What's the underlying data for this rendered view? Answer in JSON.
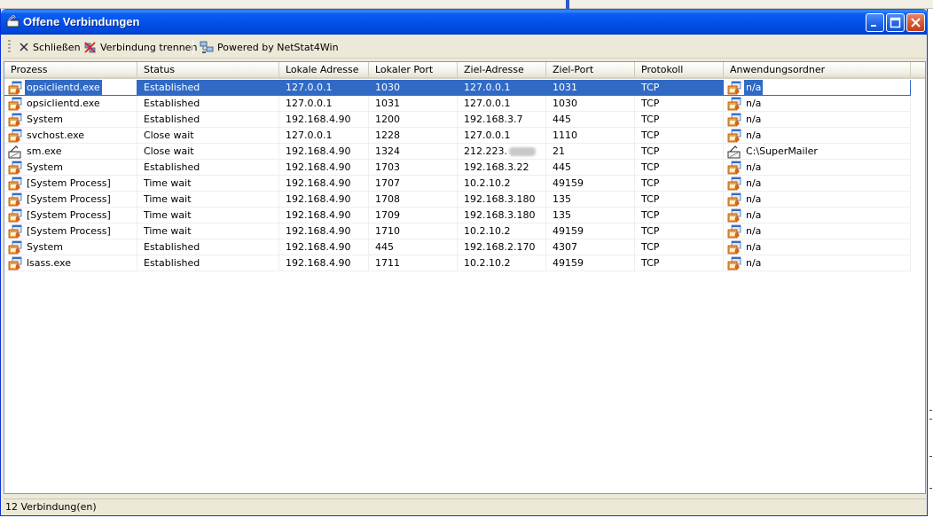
{
  "window": {
    "title": "Offene Verbindungen",
    "minimize_label": "Minimieren",
    "maximize_label": "Maximieren",
    "close_label": "Schließen"
  },
  "toolbar": {
    "close_label": "Schließen",
    "disconnect_label": "Verbindung trennen",
    "powered_label": "Powered by NetStat4Win"
  },
  "columns": [
    {
      "key": "process",
      "label": "Prozess"
    },
    {
      "key": "status",
      "label": "Status"
    },
    {
      "key": "local_address",
      "label": "Lokale Adresse"
    },
    {
      "key": "local_port",
      "label": "Lokaler Port"
    },
    {
      "key": "remote_address",
      "label": "Ziel-Adresse"
    },
    {
      "key": "remote_port",
      "label": "Ziel-Port"
    },
    {
      "key": "protocol",
      "label": "Protokoll"
    },
    {
      "key": "app_folder",
      "label": "Anwendungsordner"
    }
  ],
  "rows": [
    {
      "process": "opsiclientd.exe",
      "icon": "app-process-icon",
      "status": "Established",
      "local_address": "127.0.0.1",
      "local_port": "1030",
      "remote_address": "127.0.0.1",
      "remote_port": "1031",
      "protocol": "TCP",
      "app_folder": "n/a",
      "selected": true
    },
    {
      "process": "opsiclientd.exe",
      "icon": "app-process-icon",
      "status": "Established",
      "local_address": "127.0.0.1",
      "local_port": "1031",
      "remote_address": "127.0.0.1",
      "remote_port": "1030",
      "protocol": "TCP",
      "app_folder": "n/a"
    },
    {
      "process": "System",
      "icon": "app-process-icon",
      "status": "Established",
      "local_address": "192.168.4.90",
      "local_port": "1200",
      "remote_address": "192.168.3.7",
      "remote_port": "445",
      "protocol": "TCP",
      "app_folder": "n/a"
    },
    {
      "process": "svchost.exe",
      "icon": "app-process-icon",
      "status": "Close wait",
      "local_address": "127.0.0.1",
      "local_port": "1228",
      "remote_address": "127.0.0.1",
      "remote_port": "1110",
      "protocol": "TCP",
      "app_folder": "n/a"
    },
    {
      "process": "sm.exe",
      "icon": "supermailer-icon",
      "status": "Close wait",
      "local_address": "192.168.4.90",
      "local_port": "1324",
      "remote_address": "212.223.",
      "remote_blurred": true,
      "remote_port": "21",
      "protocol": "TCP",
      "app_folder": "C:\\SuperMailer"
    },
    {
      "process": "System",
      "icon": "app-process-icon",
      "status": "Established",
      "local_address": "192.168.4.90",
      "local_port": "1703",
      "remote_address": "192.168.3.22",
      "remote_port": "445",
      "protocol": "TCP",
      "app_folder": "n/a"
    },
    {
      "process": "[System Process]",
      "icon": "app-process-icon",
      "status": "Time wait",
      "local_address": "192.168.4.90",
      "local_port": "1707",
      "remote_address": "10.2.10.2",
      "remote_port": "49159",
      "protocol": "TCP",
      "app_folder": "n/a"
    },
    {
      "process": "[System Process]",
      "icon": "app-process-icon",
      "status": "Time wait",
      "local_address": "192.168.4.90",
      "local_port": "1708",
      "remote_address": "192.168.3.180",
      "remote_port": "135",
      "protocol": "TCP",
      "app_folder": "n/a"
    },
    {
      "process": "[System Process]",
      "icon": "app-process-icon",
      "status": "Time wait",
      "local_address": "192.168.4.90",
      "local_port": "1709",
      "remote_address": "192.168.3.180",
      "remote_port": "135",
      "protocol": "TCP",
      "app_folder": "n/a"
    },
    {
      "process": "[System Process]",
      "icon": "app-process-icon",
      "status": "Time wait",
      "local_address": "192.168.4.90",
      "local_port": "1710",
      "remote_address": "10.2.10.2",
      "remote_port": "49159",
      "protocol": "TCP",
      "app_folder": "n/a"
    },
    {
      "process": "System",
      "icon": "app-process-icon",
      "status": "Established",
      "local_address": "192.168.4.90",
      "local_port": "445",
      "remote_address": "192.168.2.170",
      "remote_port": "4307",
      "protocol": "TCP",
      "app_folder": "n/a"
    },
    {
      "process": "lsass.exe",
      "icon": "app-process-icon",
      "status": "Established",
      "local_address": "192.168.4.90",
      "local_port": "1711",
      "remote_address": "10.2.10.2",
      "remote_port": "49159",
      "protocol": "TCP",
      "app_folder": "n/a"
    }
  ],
  "statusbar": {
    "text": "12 Verbindung(en)"
  },
  "colors": {
    "title_blue": "#0054e3",
    "selection": "#316ac5",
    "face": "#ece9d8",
    "close_red": "#d8502c"
  }
}
